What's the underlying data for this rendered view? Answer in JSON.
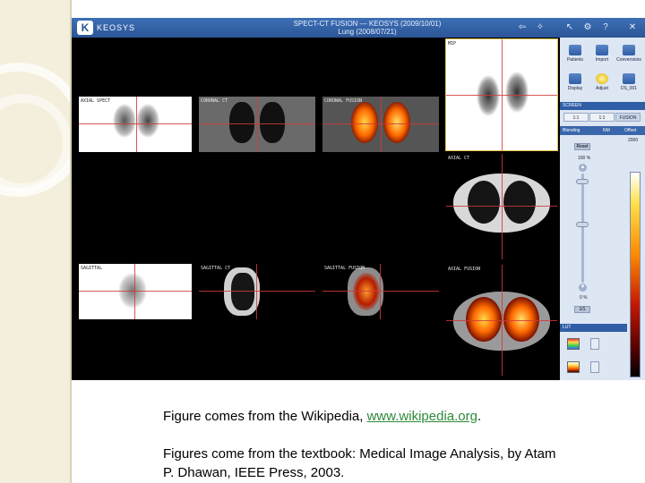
{
  "window": {
    "logo_letter": "K",
    "logo_text": "KEOSYS",
    "title_line1": "SPECT-CT FUSION — KEOSYS (2009/10/01)",
    "title_line2": "Lung (2008/07/21)"
  },
  "viewports": {
    "axial_nm_label": "AXIAL SPECT",
    "axial_ct_label": "AXIAL CT",
    "axial_fusion_label": "AXIAL FUSION",
    "coronal_ct_label": "CORONAL CT",
    "coronal_fusion_label": "CORONAL FUSION",
    "mip_label": "MIP",
    "sagittal_label": "SAGITTAL",
    "sagittal_ct_label": "SAGITTAL CT",
    "sagittal_fusion_label": "SAGITTAL FUSION"
  },
  "panel": {
    "buttons": [
      "Patients",
      "Import",
      "Conversions",
      "Display",
      "Adjust",
      "DS_001"
    ],
    "section_screen": "SCREEN",
    "segments": [
      "1:1",
      "1:1",
      "FUSION"
    ],
    "blending_label": "Blending",
    "blending_left": "NM",
    "blending_right": "Offset",
    "top_value": "2000",
    "reset_label": "Reset",
    "pct_top": "100 %",
    "pct_bottom": "0 %",
    "apply_label": "1/1",
    "section_lut": "LUT"
  },
  "caption": {
    "line1_prefix": "Figure comes from the Wikipedia, ",
    "line1_link": "www.wikipedia.org",
    "line1_suffix": ".",
    "line2": "Figures come from the textbook: Medical Image Analysis, by Atam",
    "line3": "P. Dhawan, IEEE Press, 2003."
  },
  "colors": {
    "titlebar": "#2b5596",
    "panel": "#dde6f3",
    "link": "#2e8b3a",
    "side": "#f4efdc"
  }
}
